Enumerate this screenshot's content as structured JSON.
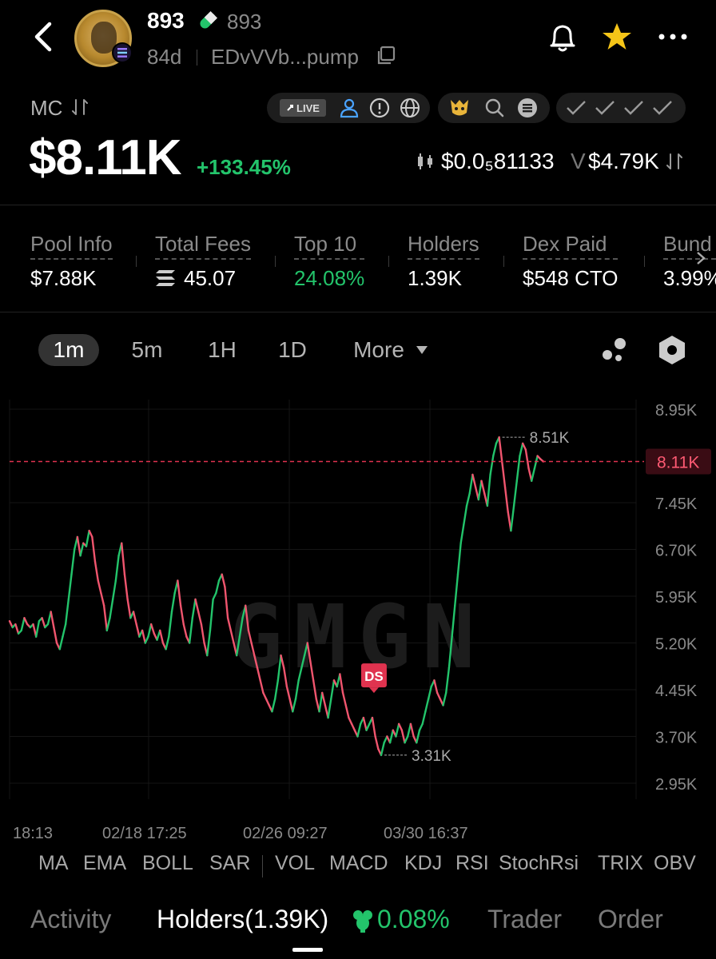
{
  "colors": {
    "up": "#23c46b",
    "down": "#f0556e",
    "accent_star": "#f5c518",
    "price_line": "#e0334f"
  },
  "header": {
    "title": "893",
    "title_secondary": "893",
    "age": "84d",
    "address": "EDvVVb...pump",
    "icons": [
      "back-icon",
      "pill-icon",
      "copy-icon",
      "bell-icon",
      "star-icon",
      "more-icon"
    ]
  },
  "market": {
    "label": "MC",
    "value": "$8.11K",
    "change": "+133.45%",
    "price": "$0.0₅81133",
    "volume_label": "V",
    "volume": "$4.79K",
    "live_label": "LIVE"
  },
  "stats": [
    {
      "label": "Pool Info",
      "value": "$7.88K"
    },
    {
      "label": "Total Fees",
      "value": "45.07"
    },
    {
      "label": "Top 10",
      "value": "24.08%"
    },
    {
      "label": "Holders",
      "value": "1.39K"
    },
    {
      "label": "Dex Paid",
      "value": "$548 CTO"
    },
    {
      "label": "Bund",
      "value": "3.99%"
    }
  ],
  "timeframes": [
    "1m",
    "5m",
    "1H",
    "1D",
    "More"
  ],
  "active_timeframe": "1m",
  "chart_data": {
    "type": "line",
    "watermark": "GMGN",
    "y_ticks": [
      "8.95K",
      "8.11K",
      "7.45K",
      "6.70K",
      "5.95K",
      "5.20K",
      "4.45K",
      "3.70K",
      "2.95K"
    ],
    "x_ticks": [
      "18:13",
      "02/18 17:25",
      "02/26 09:27",
      "03/30 16:37"
    ],
    "ylim": [
      2950,
      8950
    ],
    "current_value": 8110,
    "current_label": "8.11K",
    "high_label": "8.51K",
    "low_label": "3.31K",
    "marker_label": "DS",
    "values": [
      5.55,
      5.45,
      5.5,
      5.35,
      5.4,
      5.6,
      5.5,
      5.45,
      5.5,
      5.3,
      5.55,
      5.6,
      5.45,
      5.5,
      5.7,
      5.45,
      5.2,
      5.1,
      5.3,
      5.5,
      5.9,
      6.3,
      6.7,
      6.9,
      6.6,
      6.8,
      6.75,
      7.0,
      6.9,
      6.5,
      6.2,
      6.0,
      5.8,
      5.4,
      5.6,
      5.9,
      6.2,
      6.6,
      6.8,
      6.3,
      5.9,
      5.6,
      5.7,
      5.5,
      5.3,
      5.4,
      5.2,
      5.3,
      5.5,
      5.35,
      5.25,
      5.4,
      5.2,
      5.1,
      5.3,
      5.7,
      6.0,
      6.2,
      5.8,
      5.5,
      5.3,
      5.2,
      5.6,
      5.9,
      5.7,
      5.5,
      5.2,
      5.0,
      5.4,
      5.9,
      6.0,
      6.2,
      6.3,
      6.1,
      5.6,
      5.4,
      5.2,
      5.0,
      5.3,
      5.6,
      5.8,
      5.4,
      5.2,
      5.0,
      4.8,
      4.6,
      4.4,
      4.3,
      4.2,
      4.1,
      4.3,
      4.6,
      5.0,
      4.8,
      4.5,
      4.3,
      4.1,
      4.3,
      4.6,
      4.8,
      5.0,
      5.2,
      4.9,
      4.6,
      4.3,
      4.1,
      4.4,
      4.2,
      4.0,
      4.3,
      4.6,
      4.5,
      4.7,
      4.4,
      4.2,
      4.0,
      3.9,
      3.8,
      3.7,
      3.9,
      4.0,
      3.8,
      3.9,
      4.0,
      3.7,
      3.5,
      3.4,
      3.6,
      3.7,
      3.6,
      3.8,
      3.7,
      3.9,
      3.8,
      3.6,
      3.7,
      3.9,
      3.7,
      3.6,
      3.8,
      3.9,
      4.1,
      4.3,
      4.5,
      4.6,
      4.4,
      4.3,
      4.2,
      4.4,
      4.8,
      5.3,
      5.8,
      6.3,
      6.8,
      7.1,
      7.4,
      7.6,
      7.9,
      7.7,
      7.5,
      7.8,
      7.6,
      7.4,
      7.9,
      8.2,
      8.4,
      8.5,
      8.1,
      7.7,
      7.3,
      7.0,
      7.4,
      7.8,
      8.2,
      8.4,
      8.3,
      8.0,
      7.8,
      8.0,
      8.2,
      8.15,
      8.11
    ]
  },
  "indicators": [
    "MA",
    "EMA",
    "BOLL",
    "SAR",
    "VOL",
    "MACD",
    "KDJ",
    "RSI",
    "StochRsi",
    "TRIX",
    "OBV"
  ],
  "bottom_tabs": {
    "activity": "Activity",
    "holders": "Holders(1.39K)",
    "holders_pct": "0.08%",
    "trader": "Trader",
    "order": "Order"
  }
}
